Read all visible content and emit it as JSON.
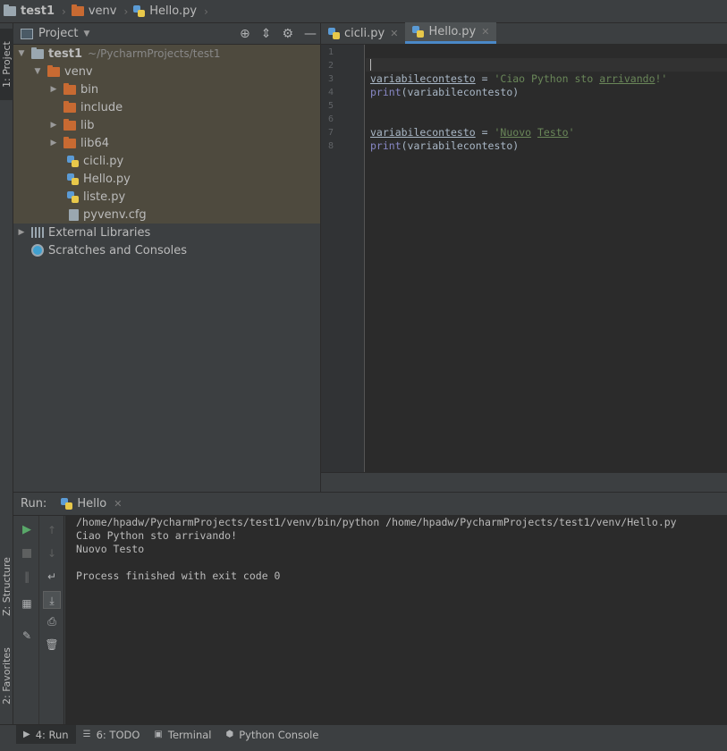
{
  "breadcrumb": [
    "test1",
    "venv",
    "Hello.py"
  ],
  "left_strip": {
    "project": "1: Project",
    "structure": "Z: Structure",
    "favorites": "2: Favorites"
  },
  "project_panel": {
    "title": "Project",
    "root_name": "test1",
    "root_path": "~/PycharmProjects/test1",
    "venv": "venv",
    "items": [
      {
        "label": "bin",
        "kind": "folder",
        "expandable": true
      },
      {
        "label": "include",
        "kind": "folder",
        "expandable": false
      },
      {
        "label": "lib",
        "kind": "folder",
        "expandable": true
      },
      {
        "label": "lib64",
        "kind": "folder",
        "expandable": true
      },
      {
        "label": "cicli.py",
        "kind": "python"
      },
      {
        "label": "Hello.py",
        "kind": "python"
      },
      {
        "label": "liste.py",
        "kind": "python"
      },
      {
        "label": "pyvenv.cfg",
        "kind": "file"
      }
    ],
    "external_libraries": "External Libraries",
    "scratches": "Scratches and Consoles"
  },
  "editor": {
    "tabs": [
      {
        "label": "cicli.py",
        "active": false
      },
      {
        "label": "Hello.py",
        "active": true
      }
    ],
    "line_numbers": [
      "1",
      "2",
      "3",
      "4",
      "5",
      "6",
      "7",
      "8"
    ],
    "lines": {
      "l3_var": "variabilecontesto",
      "l3_eq": " = ",
      "l3_str_a": "'Ciao Python sto ",
      "l3_str_b": "arrivando",
      "l3_str_c": "!'",
      "l4_fn": "print",
      "l4_rest": "(variabilecontesto)",
      "l7_var": "variabilecontesto",
      "l7_eq": " = ",
      "l7_str_a": "'",
      "l7_str_b": "Nuovo",
      "l7_str_c": " ",
      "l7_str_d": "Testo",
      "l7_str_e": "'",
      "l8_fn": "print",
      "l8_rest": "(variabilecontesto)"
    }
  },
  "run": {
    "label": "Run:",
    "tab": "Hello",
    "console": [
      "/home/hpadw/PycharmProjects/test1/venv/bin/python /home/hpadw/PycharmProjects/test1/venv/Hello.py",
      "Ciao Python sto arrivando!",
      "Nuovo Testo",
      "",
      "Process finished with exit code 0"
    ]
  },
  "bottom_tabs": [
    {
      "label": "4: Run",
      "icon": "play-icon"
    },
    {
      "label": "6: TODO",
      "icon": "list-icon"
    },
    {
      "label": "Terminal",
      "icon": "terminal-icon"
    },
    {
      "label": "Python Console",
      "icon": "python-icon"
    }
  ],
  "colors": {
    "background": "#3c3f41",
    "editor_bg": "#2b2b2b",
    "string": "#6a8759",
    "builtin": "#8888c6",
    "active_tab_accent": "#4a88c7",
    "selection": "#4e4a3e"
  }
}
